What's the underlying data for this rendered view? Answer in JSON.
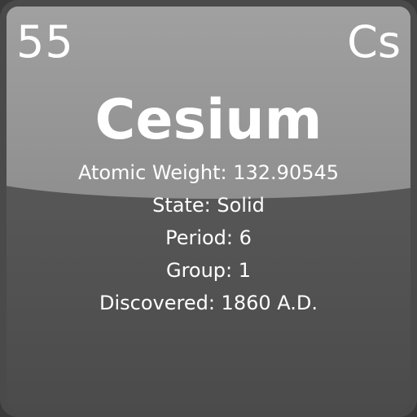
{
  "element": {
    "atomic_number": "55",
    "symbol": "Cs",
    "name": "Cesium",
    "details": [
      "Atomic Weight: 132.90545",
      "State: Solid",
      "Period: 6",
      "Group: 1",
      "Discovered: 1860 A.D."
    ]
  },
  "colors": {
    "text": "#ffffff",
    "tile_top": "#a9a9a9",
    "tile_bottom": "#555555",
    "border": "#4a4a4a"
  }
}
